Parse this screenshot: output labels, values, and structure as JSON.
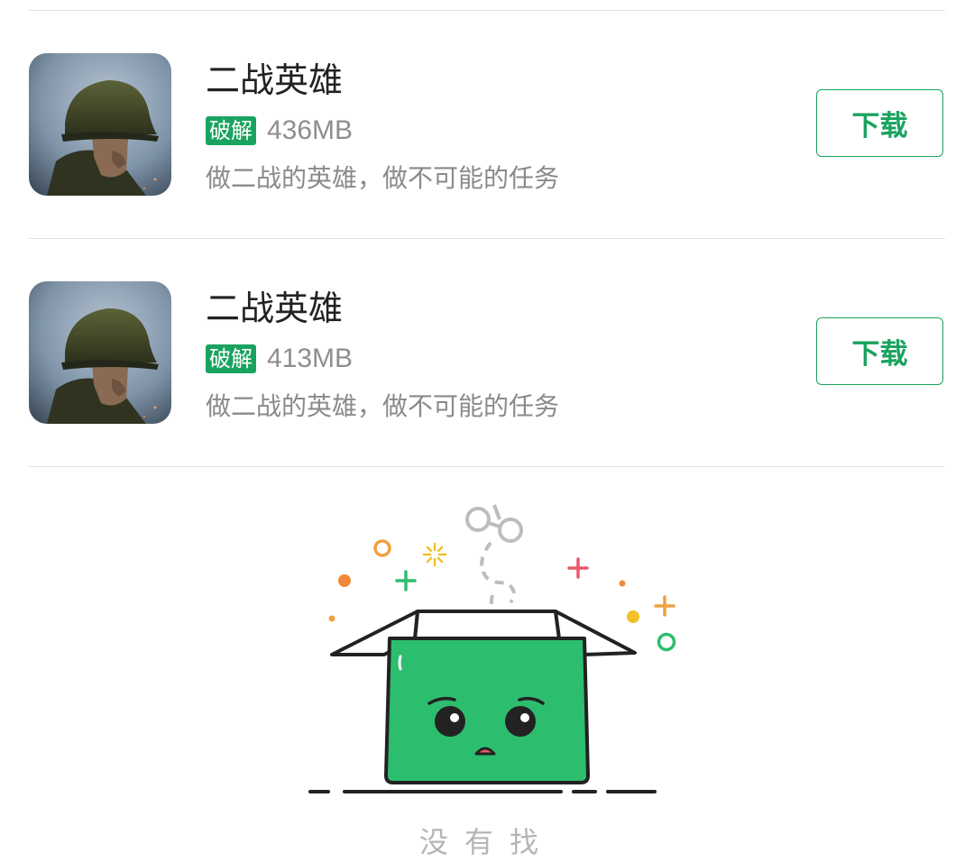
{
  "apps": [
    {
      "name": "二战英雄",
      "badge": "破解",
      "size": "436MB",
      "description": "做二战的英雄，做不可能的任务",
      "action_label": "下载"
    },
    {
      "name": "二战英雄",
      "badge": "破解",
      "size": "413MB",
      "description": "做二战的英雄，做不可能的任务",
      "action_label": "下载"
    }
  ],
  "empty_state": {
    "text": "没有找",
    "illustration": "sad-empty-box"
  },
  "colors": {
    "accent": "#1aa35f",
    "box_green": "#2dbd6e"
  }
}
